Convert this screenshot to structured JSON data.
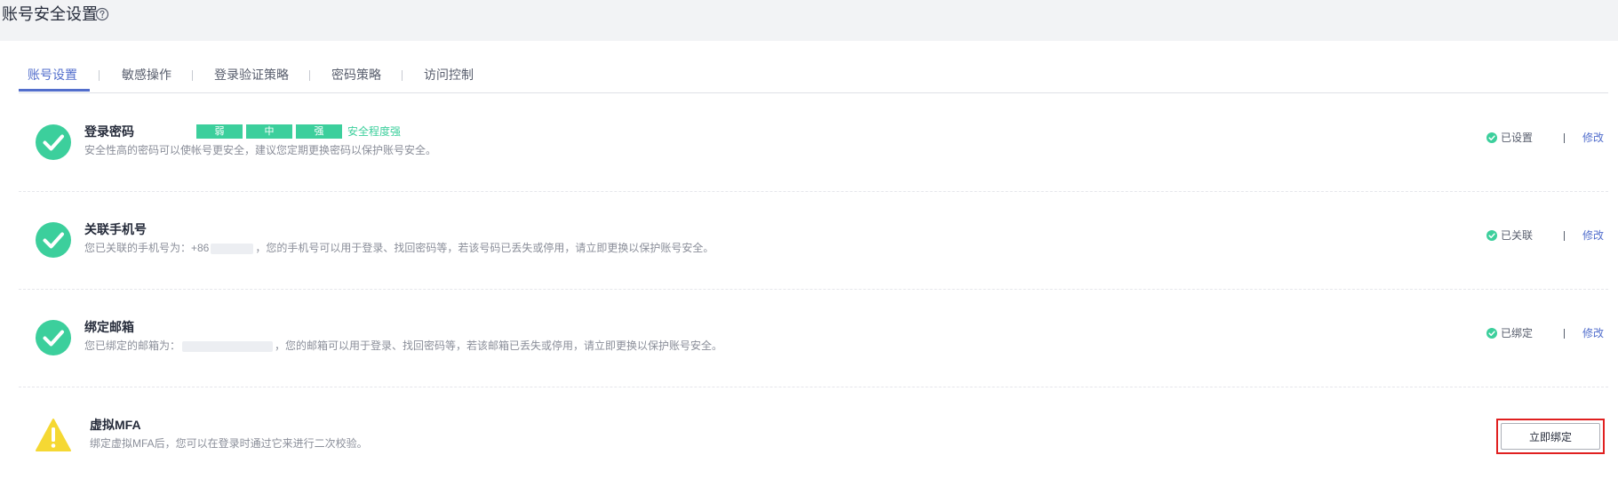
{
  "page": {
    "title": "账号安全设置",
    "help_icon": "question-circle-icon"
  },
  "tabs": [
    {
      "label": "账号设置",
      "active": true
    },
    {
      "label": "敏感操作",
      "active": false
    },
    {
      "label": "登录验证策略",
      "active": false
    },
    {
      "label": "密码策略",
      "active": false
    },
    {
      "label": "访问控制",
      "active": false
    }
  ],
  "colors": {
    "accent": "#526ecc",
    "success": "#3ccf9c",
    "warning": "#f5d833",
    "alert_border": "#e02020"
  },
  "rows": {
    "password": {
      "icon": "check-circle-icon",
      "title": "登录密码",
      "strength_levels": [
        "弱",
        "中",
        "强"
      ],
      "strength_text": "安全程度强",
      "desc": "安全性高的密码可以使帐号更安全，建议您定期更换密码以保护账号安全。",
      "status": "已设置",
      "action": "修改"
    },
    "phone": {
      "icon": "check-circle-icon",
      "title": "关联手机号",
      "desc_prefix": "您已关联的手机号为：+86",
      "desc_suffix": "，您的手机号可以用于登录、找回密码等，若该号码已丢失或停用，请立即更换以保护账号安全。",
      "status": "已关联",
      "action": "修改"
    },
    "email": {
      "icon": "check-circle-icon",
      "title": "绑定邮箱",
      "desc_prefix": "您已绑定的邮箱为：",
      "desc_suffix": "，您的邮箱可以用于登录、找回密码等，若该邮箱已丢失或停用，请立即更换以保护账号安全。",
      "status": "已绑定",
      "action": "修改"
    },
    "mfa": {
      "icon": "warning-triangle-icon",
      "title": "虚拟MFA",
      "desc": "绑定虚拟MFA后，您可以在登录时通过它来进行二次校验。",
      "button": "立即绑定"
    }
  }
}
